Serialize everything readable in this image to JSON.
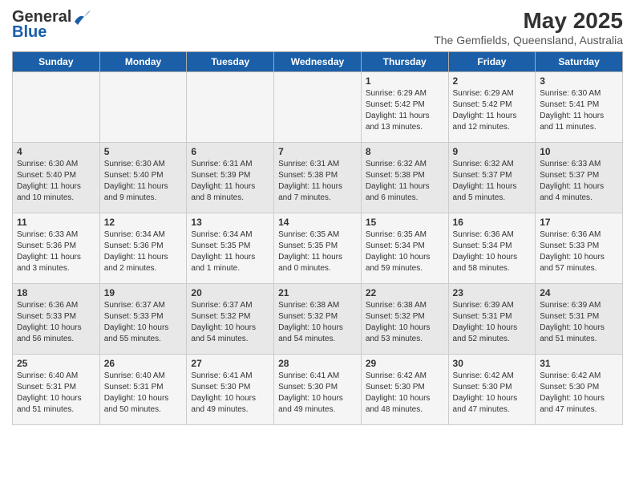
{
  "header": {
    "logo_general": "General",
    "logo_blue": "Blue",
    "month_title": "May 2025",
    "location": "The Gemfields, Queensland, Australia"
  },
  "days_of_week": [
    "Sunday",
    "Monday",
    "Tuesday",
    "Wednesday",
    "Thursday",
    "Friday",
    "Saturday"
  ],
  "weeks": [
    [
      {
        "day": "",
        "info": ""
      },
      {
        "day": "",
        "info": ""
      },
      {
        "day": "",
        "info": ""
      },
      {
        "day": "",
        "info": ""
      },
      {
        "day": "1",
        "info": "Sunrise: 6:29 AM\nSunset: 5:42 PM\nDaylight: 11 hours\nand 13 minutes."
      },
      {
        "day": "2",
        "info": "Sunrise: 6:29 AM\nSunset: 5:42 PM\nDaylight: 11 hours\nand 12 minutes."
      },
      {
        "day": "3",
        "info": "Sunrise: 6:30 AM\nSunset: 5:41 PM\nDaylight: 11 hours\nand 11 minutes."
      }
    ],
    [
      {
        "day": "4",
        "info": "Sunrise: 6:30 AM\nSunset: 5:40 PM\nDaylight: 11 hours\nand 10 minutes."
      },
      {
        "day": "5",
        "info": "Sunrise: 6:30 AM\nSunset: 5:40 PM\nDaylight: 11 hours\nand 9 minutes."
      },
      {
        "day": "6",
        "info": "Sunrise: 6:31 AM\nSunset: 5:39 PM\nDaylight: 11 hours\nand 8 minutes."
      },
      {
        "day": "7",
        "info": "Sunrise: 6:31 AM\nSunset: 5:38 PM\nDaylight: 11 hours\nand 7 minutes."
      },
      {
        "day": "8",
        "info": "Sunrise: 6:32 AM\nSunset: 5:38 PM\nDaylight: 11 hours\nand 6 minutes."
      },
      {
        "day": "9",
        "info": "Sunrise: 6:32 AM\nSunset: 5:37 PM\nDaylight: 11 hours\nand 5 minutes."
      },
      {
        "day": "10",
        "info": "Sunrise: 6:33 AM\nSunset: 5:37 PM\nDaylight: 11 hours\nand 4 minutes."
      }
    ],
    [
      {
        "day": "11",
        "info": "Sunrise: 6:33 AM\nSunset: 5:36 PM\nDaylight: 11 hours\nand 3 minutes."
      },
      {
        "day": "12",
        "info": "Sunrise: 6:34 AM\nSunset: 5:36 PM\nDaylight: 11 hours\nand 2 minutes."
      },
      {
        "day": "13",
        "info": "Sunrise: 6:34 AM\nSunset: 5:35 PM\nDaylight: 11 hours\nand 1 minute."
      },
      {
        "day": "14",
        "info": "Sunrise: 6:35 AM\nSunset: 5:35 PM\nDaylight: 11 hours\nand 0 minutes."
      },
      {
        "day": "15",
        "info": "Sunrise: 6:35 AM\nSunset: 5:34 PM\nDaylight: 10 hours\nand 59 minutes."
      },
      {
        "day": "16",
        "info": "Sunrise: 6:36 AM\nSunset: 5:34 PM\nDaylight: 10 hours\nand 58 minutes."
      },
      {
        "day": "17",
        "info": "Sunrise: 6:36 AM\nSunset: 5:33 PM\nDaylight: 10 hours\nand 57 minutes."
      }
    ],
    [
      {
        "day": "18",
        "info": "Sunrise: 6:36 AM\nSunset: 5:33 PM\nDaylight: 10 hours\nand 56 minutes."
      },
      {
        "day": "19",
        "info": "Sunrise: 6:37 AM\nSunset: 5:33 PM\nDaylight: 10 hours\nand 55 minutes."
      },
      {
        "day": "20",
        "info": "Sunrise: 6:37 AM\nSunset: 5:32 PM\nDaylight: 10 hours\nand 54 minutes."
      },
      {
        "day": "21",
        "info": "Sunrise: 6:38 AM\nSunset: 5:32 PM\nDaylight: 10 hours\nand 54 minutes."
      },
      {
        "day": "22",
        "info": "Sunrise: 6:38 AM\nSunset: 5:32 PM\nDaylight: 10 hours\nand 53 minutes."
      },
      {
        "day": "23",
        "info": "Sunrise: 6:39 AM\nSunset: 5:31 PM\nDaylight: 10 hours\nand 52 minutes."
      },
      {
        "day": "24",
        "info": "Sunrise: 6:39 AM\nSunset: 5:31 PM\nDaylight: 10 hours\nand 51 minutes."
      }
    ],
    [
      {
        "day": "25",
        "info": "Sunrise: 6:40 AM\nSunset: 5:31 PM\nDaylight: 10 hours\nand 51 minutes."
      },
      {
        "day": "26",
        "info": "Sunrise: 6:40 AM\nSunset: 5:31 PM\nDaylight: 10 hours\nand 50 minutes."
      },
      {
        "day": "27",
        "info": "Sunrise: 6:41 AM\nSunset: 5:30 PM\nDaylight: 10 hours\nand 49 minutes."
      },
      {
        "day": "28",
        "info": "Sunrise: 6:41 AM\nSunset: 5:30 PM\nDaylight: 10 hours\nand 49 minutes."
      },
      {
        "day": "29",
        "info": "Sunrise: 6:42 AM\nSunset: 5:30 PM\nDaylight: 10 hours\nand 48 minutes."
      },
      {
        "day": "30",
        "info": "Sunrise: 6:42 AM\nSunset: 5:30 PM\nDaylight: 10 hours\nand 47 minutes."
      },
      {
        "day": "31",
        "info": "Sunrise: 6:42 AM\nSunset: 5:30 PM\nDaylight: 10 hours\nand 47 minutes."
      }
    ]
  ]
}
